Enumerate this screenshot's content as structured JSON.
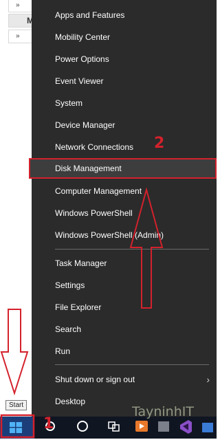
{
  "background_window": {
    "rows": [
      {
        "chevron": "»",
        "letter": ""
      },
      {
        "chevron": "",
        "letter": "M"
      },
      {
        "chevron": "»",
        "letter": ""
      }
    ]
  },
  "menu": {
    "items": [
      {
        "label": "Apps and Features"
      },
      {
        "label": "Mobility Center"
      },
      {
        "label": "Power Options"
      },
      {
        "label": "Event Viewer"
      },
      {
        "label": "System"
      },
      {
        "label": "Device Manager"
      },
      {
        "label": "Network Connections"
      },
      {
        "label": "Disk Management"
      },
      {
        "label": "Computer Management"
      },
      {
        "label": "Windows PowerShell"
      },
      {
        "label": "Windows PowerShell (Admin)"
      },
      {
        "label": "Task Manager"
      },
      {
        "label": "Settings"
      },
      {
        "label": "File Explorer"
      },
      {
        "label": "Search"
      },
      {
        "label": "Run"
      },
      {
        "label": "Shut down or sign out"
      },
      {
        "label": "Desktop"
      }
    ],
    "submenu_arrow": "›"
  },
  "taskbar": {
    "start_tooltip": "Start"
  },
  "annotations": {
    "step1": "1",
    "step2": "2"
  },
  "watermark": "TayninhIT",
  "colors": {
    "menu_bg": "#2b2b2b",
    "highlight_border": "#d4212c",
    "taskbar_bg": "#101522",
    "start_bg": "#1b3e7a"
  },
  "icons": {
    "start": "windows-logo-icon",
    "search": "search-circle-icon",
    "task_view": "task-view-icon",
    "store": "store-bag-icon",
    "media": "media-player-icon",
    "visual_studio": "visual-studio-icon"
  }
}
